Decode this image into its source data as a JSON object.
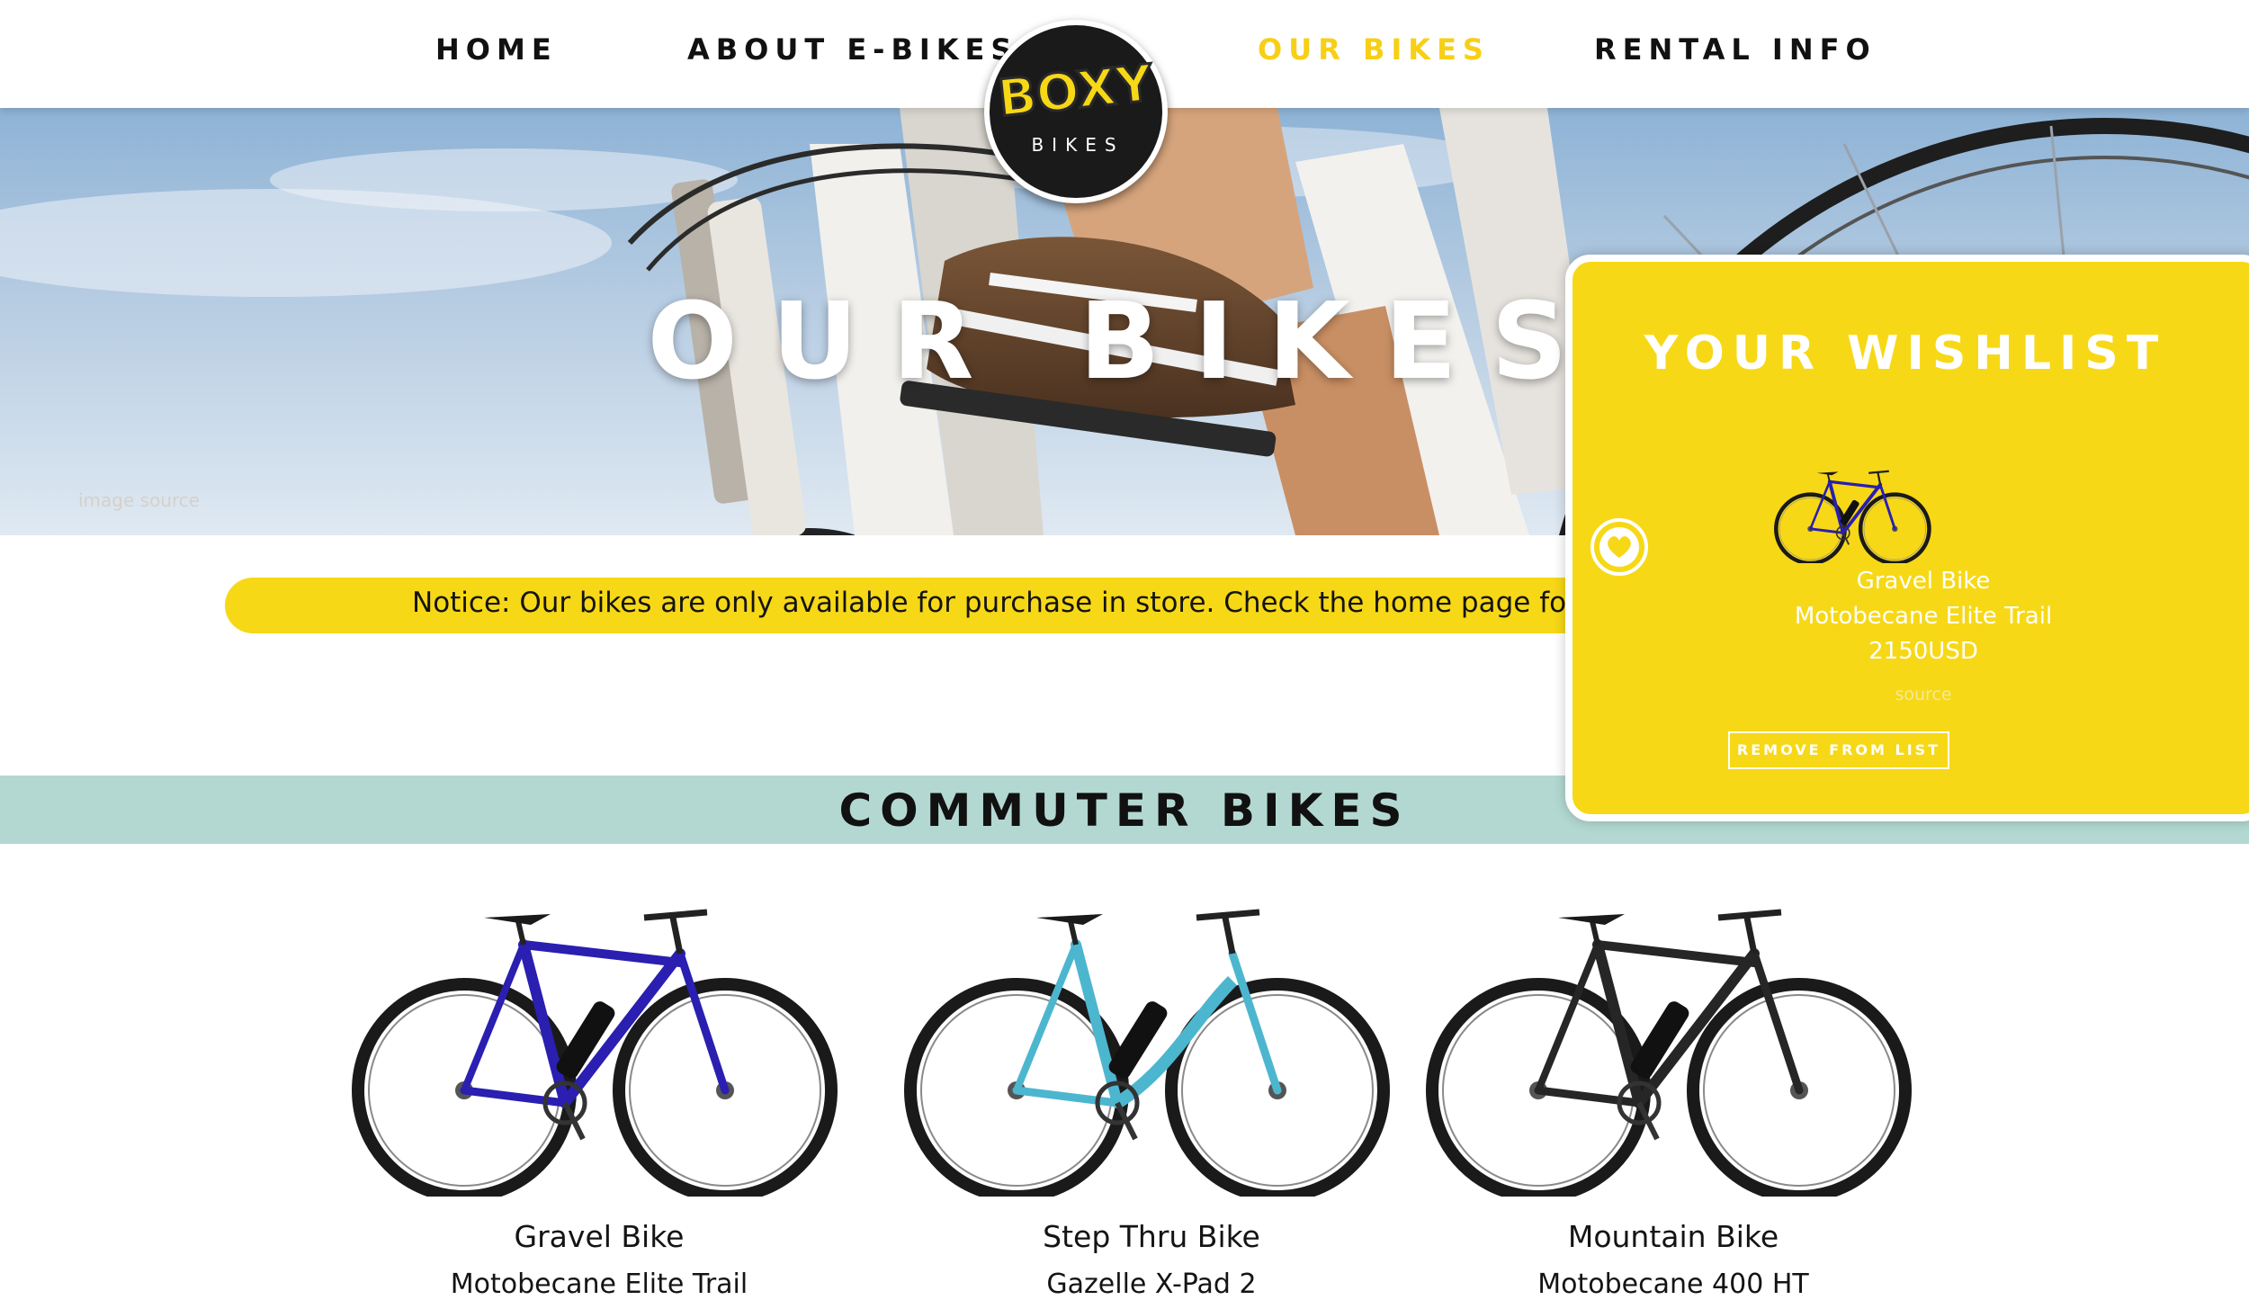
{
  "nav": {
    "home": "HOME",
    "about": "ABOUT E-BIKES",
    "our_bikes": "OUR BIKES",
    "rental": "RENTAL INFO",
    "active_color": "#f7cf16"
  },
  "logo": {
    "line1": "BOXY",
    "line2": "BIKES"
  },
  "hero": {
    "title": "OUR BIKES",
    "image_source": "image source"
  },
  "notice": {
    "text": "Notice: Our bikes are only available for purchase in store. Check the home page for ou"
  },
  "section": {
    "title": "COMMUTER BIKES"
  },
  "products": [
    {
      "category": "Gravel Bike",
      "model": "Motobecane Elite Trail",
      "color": "#2a1fb0"
    },
    {
      "category": "Step Thru Bike",
      "model": "Gazelle X-Pad 2",
      "color": "#4db6cf"
    },
    {
      "category": "Mountain Bike",
      "model": "Motobecane 400 HT",
      "color": "#262626"
    }
  ],
  "wishlist": {
    "title": "YOUR WISHLIST",
    "item_category": "Gravel Bike",
    "item_model": "Motobecane Elite Trail",
    "item_price": "2150USD",
    "source": "source",
    "remove_label": "REMOVE FROM LIST"
  },
  "colors": {
    "brand_yellow": "#f7d816",
    "band_teal": "#b3d8d2"
  }
}
